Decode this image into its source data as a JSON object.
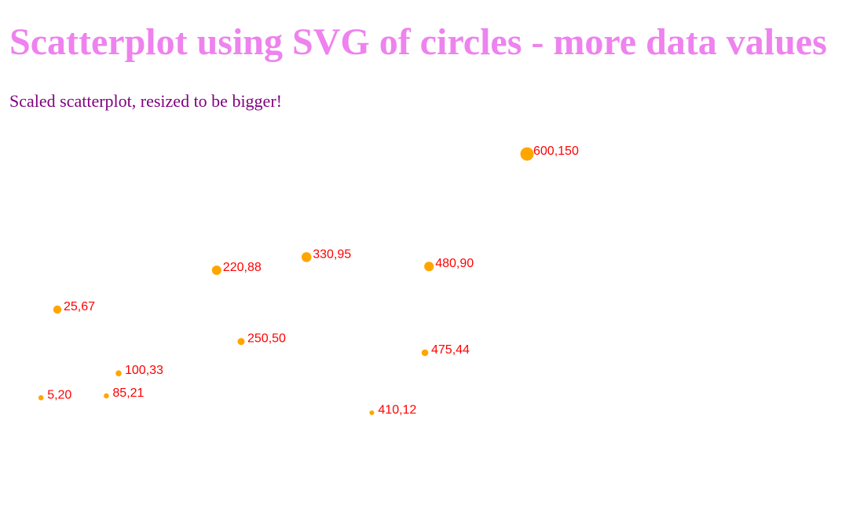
{
  "page": {
    "title": "Scatterplot using SVG of circles - more data values",
    "subtitle": "Scaled scatterplot, resized to be bigger!"
  },
  "colors": {
    "title": "#ee82ee",
    "subtitle": "#800080",
    "point_fill": "#ffa500",
    "label_text": "#ff0000",
    "background": "#ffffff"
  },
  "chart_data": {
    "type": "scatter",
    "title": "",
    "xlabel": "",
    "ylabel": "",
    "grid": false,
    "axes_visible": false,
    "xlim": [
      0,
      600
    ],
    "ylim": [
      0,
      150
    ],
    "points": [
      {
        "x": 5,
        "y": 20,
        "label": "5,20"
      },
      {
        "x": 480,
        "y": 90,
        "label": "480,90"
      },
      {
        "x": 250,
        "y": 50,
        "label": "250,50"
      },
      {
        "x": 100,
        "y": 33,
        "label": "100,33"
      },
      {
        "x": 330,
        "y": 95,
        "label": "330,95"
      },
      {
        "x": 410,
        "y": 12,
        "label": "410,12"
      },
      {
        "x": 475,
        "y": 44,
        "label": "475,44"
      },
      {
        "x": 25,
        "y": 67,
        "label": "25,67"
      },
      {
        "x": 85,
        "y": 21,
        "label": "85,21"
      },
      {
        "x": 220,
        "y": 88,
        "label": "220,88"
      },
      {
        "x": 600,
        "y": 150,
        "label": "600,150"
      }
    ]
  }
}
